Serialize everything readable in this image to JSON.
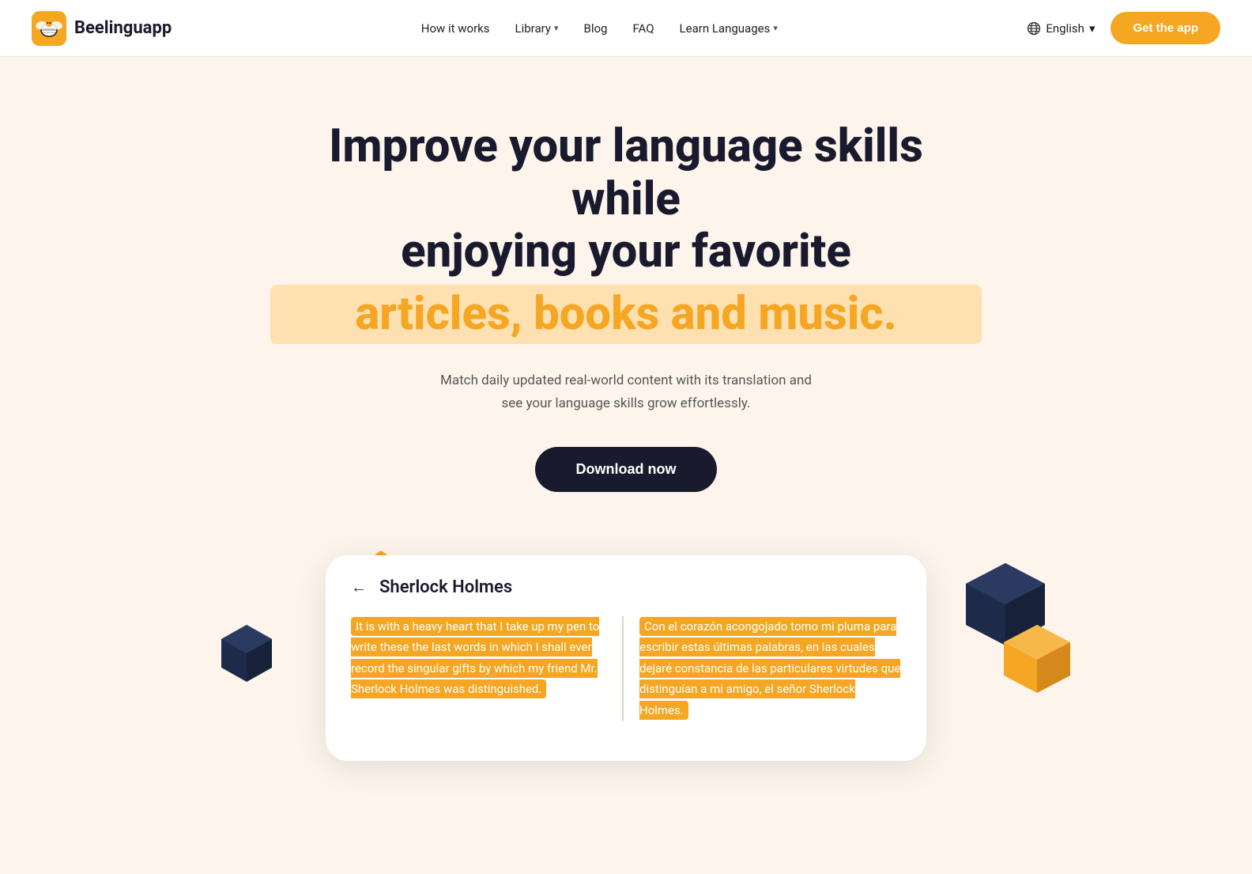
{
  "brand": {
    "logo_text": "Beelinguapp",
    "logo_icon": "bee"
  },
  "nav": {
    "links": [
      {
        "label": "How it works",
        "has_dropdown": false
      },
      {
        "label": "Library",
        "has_dropdown": true
      },
      {
        "label": "Blog",
        "has_dropdown": false
      },
      {
        "label": "FAQ",
        "has_dropdown": false
      },
      {
        "label": "Learn Languages",
        "has_dropdown": true
      }
    ],
    "lang": {
      "label": "English",
      "has_dropdown": true
    },
    "cta_label": "Get the app"
  },
  "hero": {
    "headline_line1": "Improve your language skills while",
    "headline_line2": "enjoying your favorite",
    "headline_highlight": "articles, books and music.",
    "sub": "Match daily updated real-world content with its translation and see your language skills grow effortlessly.",
    "cta_label": "Download now"
  },
  "app_preview": {
    "card_title": "Sherlock Holmes",
    "text_en": "It is with a heavy heart that I take up my pen to write these the last words in which I shall ever record the singular gifts by which my friend Mr. Sherlock Holmes was distinguished.",
    "text_es": "Con el corazón acongojado tomo mi pluma para escribir estas últimas palabras, en las cuales dejaré constancia de las particulares virtudes que distinguían a mi amigo, el señor Sherlock Holmes."
  },
  "colors": {
    "orange": "#f5a623",
    "dark_navy": "#1a1a2e",
    "bg": "#fdf5ec",
    "highlight_bg": "#ffe0b0"
  }
}
